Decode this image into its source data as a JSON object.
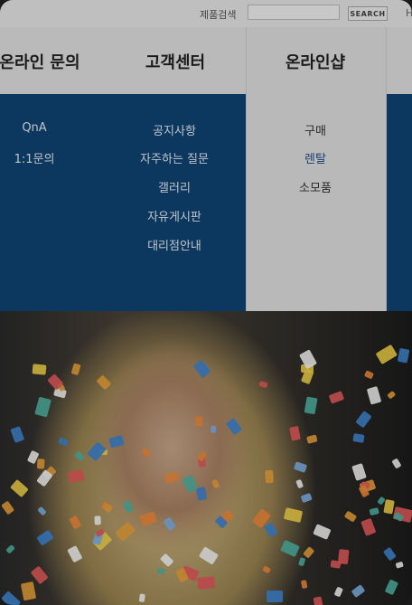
{
  "search": {
    "label": "제품검색",
    "placeholder": "",
    "button_label": "SEARCH",
    "top_right_text": "H"
  },
  "menu": {
    "columns": [
      {
        "title": "온라인 문의",
        "items": [
          "QnA",
          "1:1문의"
        ]
      },
      {
        "title": "고객센터",
        "items": [
          "공지사항",
          "자주하는 질문",
          "갤러리",
          "자유게시판",
          "대리점안내"
        ]
      },
      {
        "title": "온라인샵",
        "items": [
          "구매",
          "렌탈",
          "소모품"
        ],
        "active_item": "렌탈"
      }
    ]
  },
  "colors": {
    "menu_blue": "#0f4576",
    "active_link": "#1e4f8a",
    "header_gray": "#e3e3e3"
  }
}
